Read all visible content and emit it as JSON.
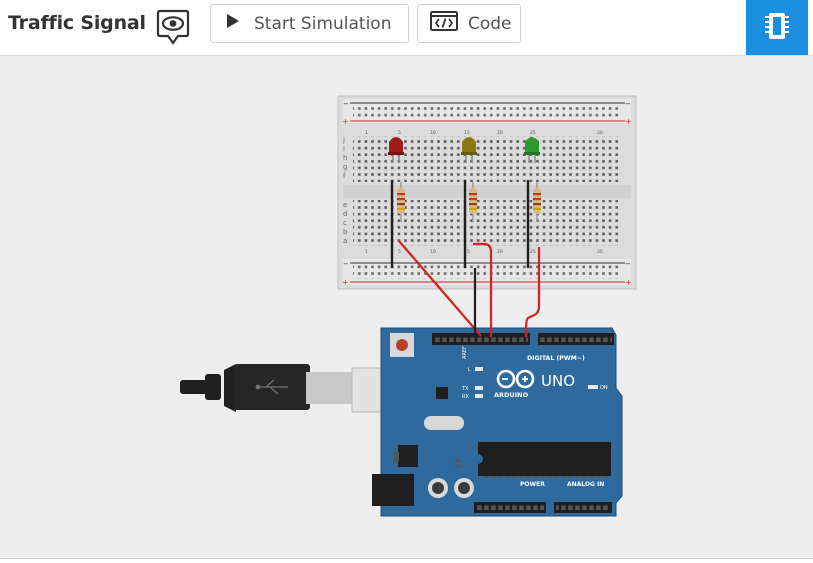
{
  "header": {
    "title": "Traffic Signal",
    "start_simulation_label": "Start Simulation",
    "code_label": "Code"
  },
  "icons": {
    "visibility": "eye-icon",
    "play": "play-icon",
    "code": "code-window-icon",
    "components": "component-chip-icon"
  },
  "colors": {
    "accent": "#1a8fdf",
    "workspace": "#eeeeee",
    "board": "#2f6a9e",
    "led_red": "#a11a1a",
    "led_yellow": "#8a7716",
    "led_green": "#2e9a2e",
    "wire_red": "#d4211b",
    "wire_black": "#1f1f1f"
  },
  "circuit": {
    "breadboard": {
      "row_letters_top": [
        "j",
        "i",
        "h",
        "g",
        "f"
      ],
      "row_letters_bottom": [
        "e",
        "d",
        "c",
        "b",
        "a"
      ]
    },
    "leds": [
      {
        "name": "red-led",
        "color": "red"
      },
      {
        "name": "yellow-led",
        "color": "yellow"
      },
      {
        "name": "green-led",
        "color": "green"
      }
    ],
    "arduino": {
      "model": "UNO",
      "brand": "ARDUINO",
      "digital_label": "DIGITAL (PWM~)",
      "power_label": "POWER",
      "analog_label": "ANALOG IN",
      "on_label": "ON",
      "tx_label": "TX",
      "rx_label": "RX",
      "l_label": "L",
      "aref_label": "AREF",
      "gnd_label": "GND",
      "digital_pins": [
        "13",
        "12",
        "~11",
        "~10",
        "~9",
        "8",
        "7",
        "~6",
        "~5",
        "4",
        "~3",
        "2",
        "TX→1",
        "RX←0"
      ],
      "power_pins": [
        "IOREF",
        "RESET",
        "3.3V",
        "5V",
        "GND",
        "GND",
        "Vin"
      ],
      "analog_pins": [
        "A0",
        "A1",
        "A2",
        "A3",
        "A4",
        "A5"
      ]
    }
  }
}
